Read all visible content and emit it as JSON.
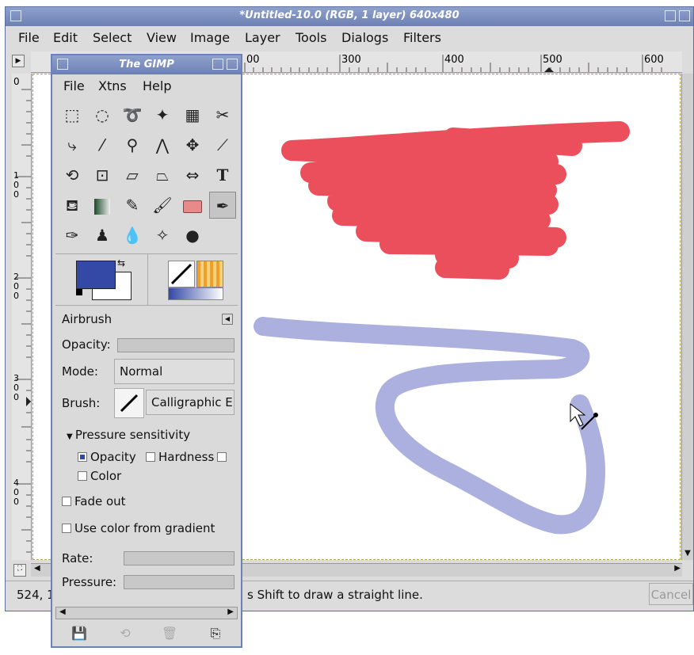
{
  "image_window": {
    "title": "*Untitled-10.0 (RGB, 1 layer) 640x480",
    "menu": [
      "File",
      "Edit",
      "Select",
      "View",
      "Image",
      "Layer",
      "Tools",
      "Dialogs",
      "Filters"
    ],
    "ruler_h_labels": [
      "00",
      "300",
      "400",
      "500",
      "600"
    ],
    "ruler_v_labels": [
      "0",
      "1\n0\n0",
      "2\n0\n0",
      "3\n0\n0",
      "4\n0\n0"
    ],
    "status": {
      "coords": "524, 1",
      "message": "s Shift to draw a straight line.",
      "cancel_label": "Cancel"
    },
    "colors": {
      "red_stroke": "#e8303f",
      "blue_stroke": "#7e86cc"
    }
  },
  "toolbox": {
    "title": "The GIMP",
    "menu": [
      "File",
      "Xtns",
      "Help"
    ],
    "tool_icons": [
      "rect-select-icon",
      "ellipse-select-icon",
      "lasso-icon",
      "fuzzy-select-icon",
      "color-select-icon",
      "scissors-icon",
      "paths-icon",
      "color-picker-icon",
      "zoom-icon",
      "measure-icon",
      "move-icon",
      "crop-icon",
      "rotate-icon",
      "scale-icon",
      "shear-icon",
      "perspective-icon",
      "flip-icon",
      "text-icon",
      "bucket-fill-icon",
      "blend-icon",
      "pencil-icon",
      "paintbrush-icon",
      "eraser-icon",
      "airbrush-icon",
      "ink-icon",
      "clone-icon",
      "smudge-icon",
      "convolve-icon",
      "dodge-burn-icon"
    ],
    "colors": {
      "foreground": "#3448a6",
      "background": "#ffffff"
    },
    "options": {
      "title": "Airbrush",
      "opacity_label": "Opacity:",
      "mode_label": "Mode:",
      "mode_value": "Normal",
      "brush_label": "Brush:",
      "brush_value": "Calligraphic E",
      "pressure_header": "Pressure sensitivity",
      "pressure_opacity": "Opacity",
      "pressure_hardness": "Hardness",
      "pressure_color": "Color",
      "fade_out": "Fade out",
      "use_gradient": "Use color from gradient",
      "rate_label": "Rate:",
      "pressure_label": "Pressure:"
    }
  }
}
